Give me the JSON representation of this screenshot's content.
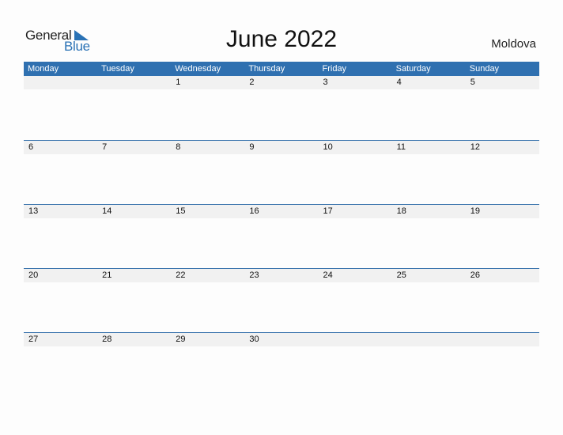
{
  "logo": {
    "word1": "General",
    "word2": "Blue"
  },
  "title": "June 2022",
  "country": "Moldova",
  "weekdays": [
    "Monday",
    "Tuesday",
    "Wednesday",
    "Thursday",
    "Friday",
    "Saturday",
    "Sunday"
  ],
  "weeks": [
    [
      "",
      "",
      "1",
      "2",
      "3",
      "4",
      "5"
    ],
    [
      "6",
      "7",
      "8",
      "9",
      "10",
      "11",
      "12"
    ],
    [
      "13",
      "14",
      "15",
      "16",
      "17",
      "18",
      "19"
    ],
    [
      "20",
      "21",
      "22",
      "23",
      "24",
      "25",
      "26"
    ],
    [
      "27",
      "28",
      "29",
      "30",
      "",
      "",
      ""
    ]
  ],
  "colors": {
    "accent": "#2f70b0",
    "date_strip": "#f1f1f1"
  }
}
